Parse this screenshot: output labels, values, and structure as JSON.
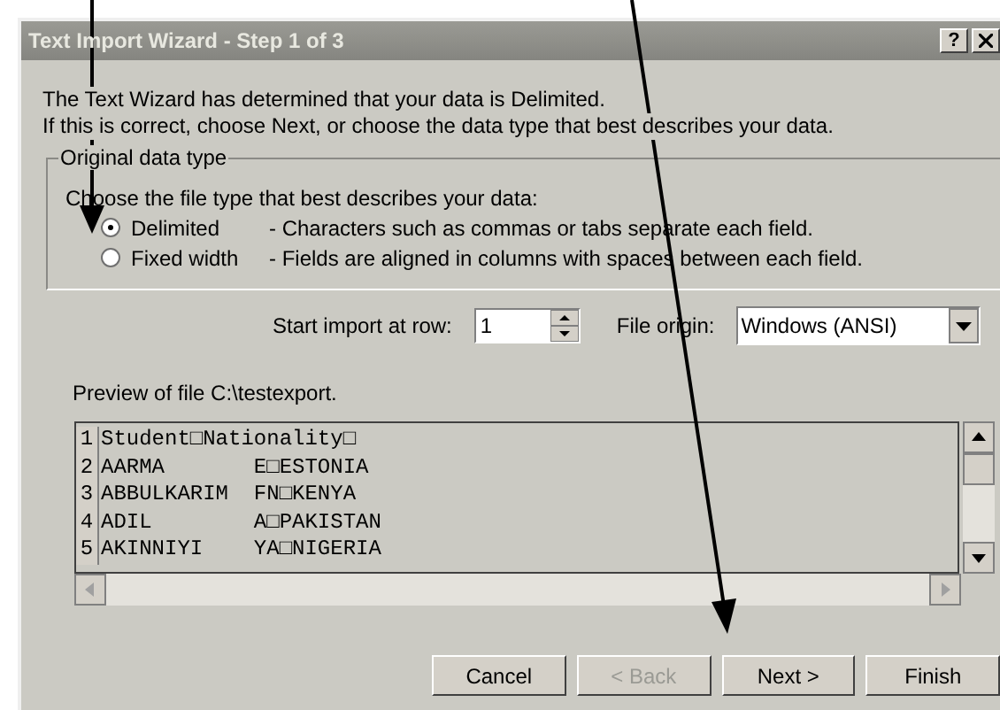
{
  "window": {
    "title": "Text Import Wizard - Step 1 of 3",
    "title_buttons": [
      "?"
    ]
  },
  "intro": [
    "The Text Wizard has determined that your data is Delimited.",
    "If this is correct, choose Next, or choose the data type that best describes your data."
  ],
  "data_type": {
    "label": "Original data type",
    "prompt": "Choose the file type that best describes your data:",
    "options": [
      {
        "label": "Delimited",
        "description": "- Characters such as commas or tabs separate each field.",
        "selected": true
      },
      {
        "label": "Fixed width",
        "description": "- Fields are aligned in columns with spaces between each field.",
        "selected": false
      }
    ]
  },
  "start_row": {
    "label": "Start import at row:",
    "value": "1"
  },
  "file_origin": {
    "label": "File origin:",
    "value": "Windows (ANSI)"
  },
  "preview": {
    "label": "Preview of file C:\\testexport.",
    "lines": [
      {
        "number": "1",
        "text": "Student□Nationality□"
      },
      {
        "number": "2",
        "text": "AARMA       E□ESTONIA"
      },
      {
        "number": "3",
        "text": "ABBULKARIM  FN□KENYA"
      },
      {
        "number": "4",
        "text": "ADIL        A□PAKISTAN"
      },
      {
        "number": "5",
        "text": "AKINNIYI    YA□NIGERIA"
      }
    ]
  },
  "buttons": [
    {
      "label": "Cancel",
      "disabled": false
    },
    {
      "label": "< Back",
      "disabled": true
    },
    {
      "label": "Next >",
      "disabled": false
    },
    {
      "label": "Finish",
      "disabled": false
    }
  ]
}
